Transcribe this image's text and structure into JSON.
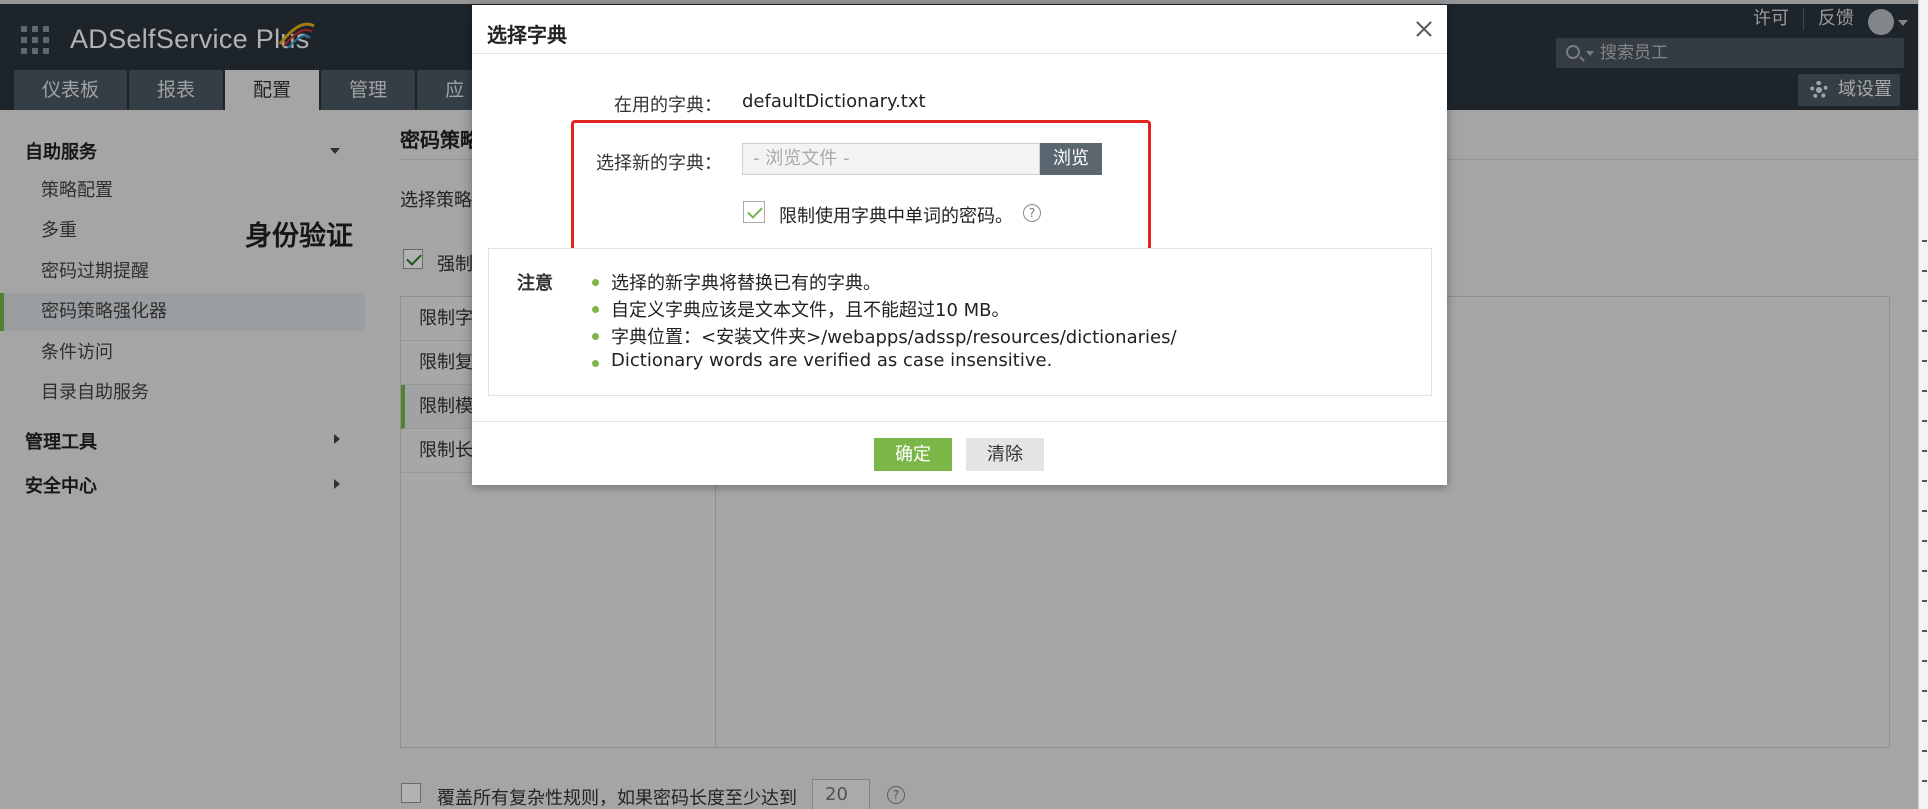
{
  "app": {
    "title": "ADSelfService Plus"
  },
  "header": {
    "links": [
      "许可",
      "反馈"
    ],
    "search_placeholder": "搜索员工",
    "domain_settings": "域设置"
  },
  "nav": {
    "tabs": [
      "仪表板",
      "报表",
      "配置",
      "管理",
      "应"
    ]
  },
  "sidebar": {
    "section_self_service": "自助服务",
    "items": [
      "策略配置",
      "多重",
      "密码过期提醒",
      "密码策略强化器",
      "条件访问",
      "目录自助服务"
    ],
    "overlay_label": "身份验证",
    "section_admin_tools": "管理工具",
    "section_security_center": "安全中心"
  },
  "main": {
    "title": "密码策略",
    "select_policy": "选择策略",
    "enforce_label": "强制",
    "rules": [
      "限制字",
      "限制复",
      "限制模",
      "限制长"
    ],
    "override_label": "覆盖所有复杂性规则，如果密码长度至少达到",
    "override_value": "20"
  },
  "dialog": {
    "title": "选择字典",
    "current_label": "在用的字典：",
    "current_value": "defaultDictionary.txt",
    "new_label": "选择新的字典：",
    "file_placeholder": "- 浏览文件 -",
    "browse_label": "浏览",
    "restrict_label": "限制使用字典中单词的密码。",
    "note_label": "注意",
    "notes": [
      "选择的新字典将替换已有的字典。",
      "自定义字典应该是文本文件，且不能超过10 MB。",
      "字典位置：<安装文件夹>/webapps/adssp/resources/dictionaries/",
      "Dictionary words are verified as case insensitive."
    ],
    "ok_label": "确定",
    "clear_label": "清除"
  }
}
